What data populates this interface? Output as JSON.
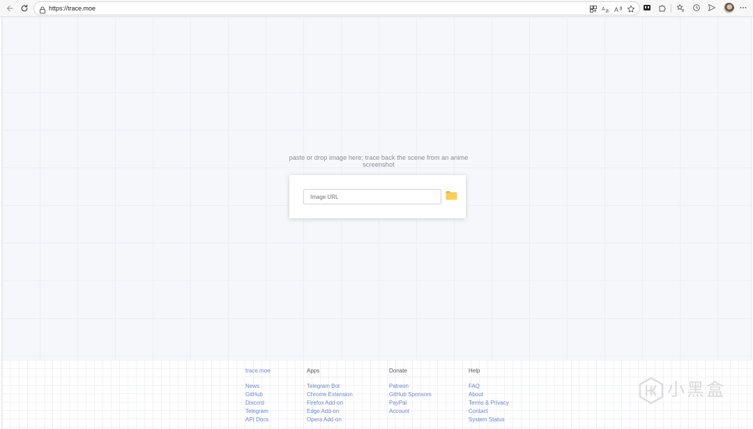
{
  "browser": {
    "url": "https://trace.moe"
  },
  "main": {
    "tagline": "paste or drop image here; trace back the scene from an anime screenshot",
    "url_input_placeholder": "Image URL"
  },
  "footer": {
    "columns": [
      {
        "heading": "trace.moe",
        "links": [
          "News",
          "GitHub",
          "Discord",
          "Telegram",
          "API Docs"
        ]
      },
      {
        "heading": "Apps",
        "links": [
          "Telegram Bot",
          "Chrome Extension",
          "Firefox Add-on",
          "Edge Add-on",
          "Opera Add-on"
        ]
      },
      {
        "heading": "Donate",
        "links": [
          "Patreon",
          "GitHub Sponsors",
          "PayPal",
          "Account"
        ]
      },
      {
        "heading": "Help",
        "links": [
          "FAQ",
          "About",
          "Terms & Privacy",
          "Contact",
          "System Status"
        ]
      }
    ]
  },
  "watermark": {
    "text": "小黑盒"
  },
  "colors": {
    "link": "#6a86d8",
    "folder": "#f6c544",
    "page_bg": "#f6f7fb"
  },
  "icons": {
    "back": "back-arrow-icon",
    "refresh": "refresh-icon",
    "lock": "lock-icon",
    "folder": "folder-icon"
  }
}
